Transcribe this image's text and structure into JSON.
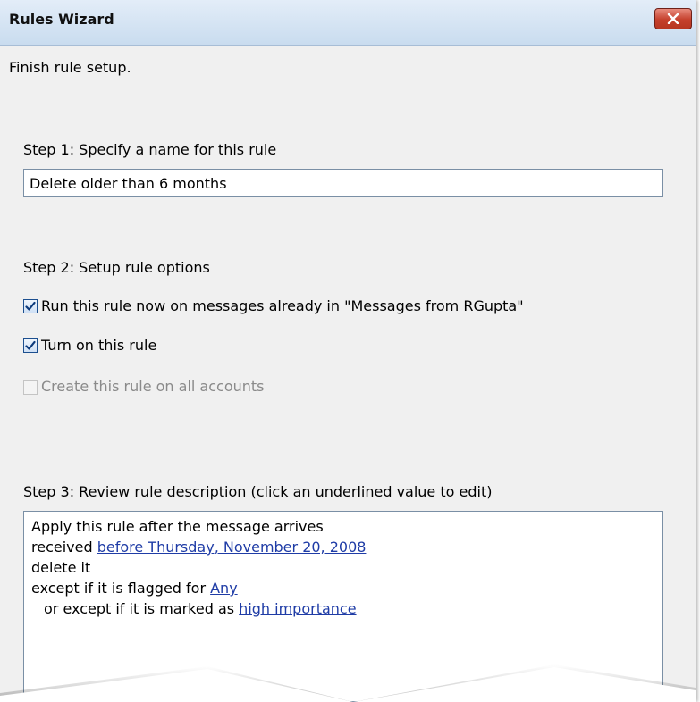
{
  "window": {
    "title": "Rules Wizard",
    "close_label": "×"
  },
  "header": {
    "instruction": "Finish rule setup."
  },
  "step1": {
    "label": "Step 1: Specify a name for this rule",
    "rule_name_value": "Delete older than 6 months"
  },
  "step2": {
    "label": "Step 2: Setup rule options",
    "options": [
      {
        "label": "Run this rule now on messages already in \"Messages from RGupta\"",
        "checked": true,
        "enabled": true
      },
      {
        "label": "Turn on this rule",
        "checked": true,
        "enabled": true
      },
      {
        "label": "Create this rule on all accounts",
        "checked": false,
        "enabled": false
      }
    ]
  },
  "step3": {
    "label": "Step 3: Review rule description (click an underlined value to edit)",
    "lines": {
      "line1": "Apply this rule after the message arrives",
      "line2_prefix": "received ",
      "line2_link": "before Thursday, November 20, 2008",
      "line3": "delete it",
      "line4_prefix": "except if it is flagged for ",
      "line4_link": "Any",
      "line5_prefix": "or except if it is marked as ",
      "line5_link": "high importance"
    }
  },
  "colors": {
    "title_bar": "#c9dcef",
    "close_button": "#c5402c",
    "link": "#1f3ca6",
    "disabled_text": "#8a8a8a"
  },
  "icons": {
    "close": "close-x-icon",
    "checkmark": "checkmark-icon"
  }
}
